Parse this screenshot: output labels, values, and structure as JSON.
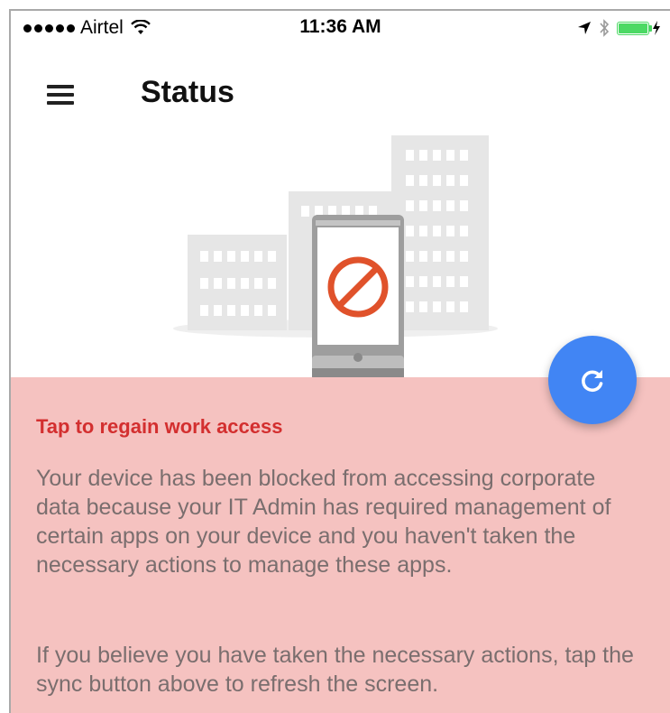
{
  "status_bar": {
    "carrier": "Airtel",
    "time": "11:36 AM"
  },
  "app_bar": {
    "title": "Status"
  },
  "message": {
    "title": "Tap to regain work access",
    "body": "Your device has been blocked from accessing corporate data because your IT Admin has required management of certain apps on your device and you haven't taken the necessary actions to manage these apps.",
    "body2": "If you believe you have taken the necessary actions, tap the sync button above to refresh the screen."
  },
  "colors": {
    "panel_bg": "#f5c2c0",
    "accent_red": "#d32f2f",
    "fab_blue": "#4185f4",
    "blocked_orange": "#e0522b"
  },
  "icons": {
    "menu": "hamburger-menu-icon",
    "sync": "refresh-icon",
    "blocked": "no-entry-icon"
  }
}
